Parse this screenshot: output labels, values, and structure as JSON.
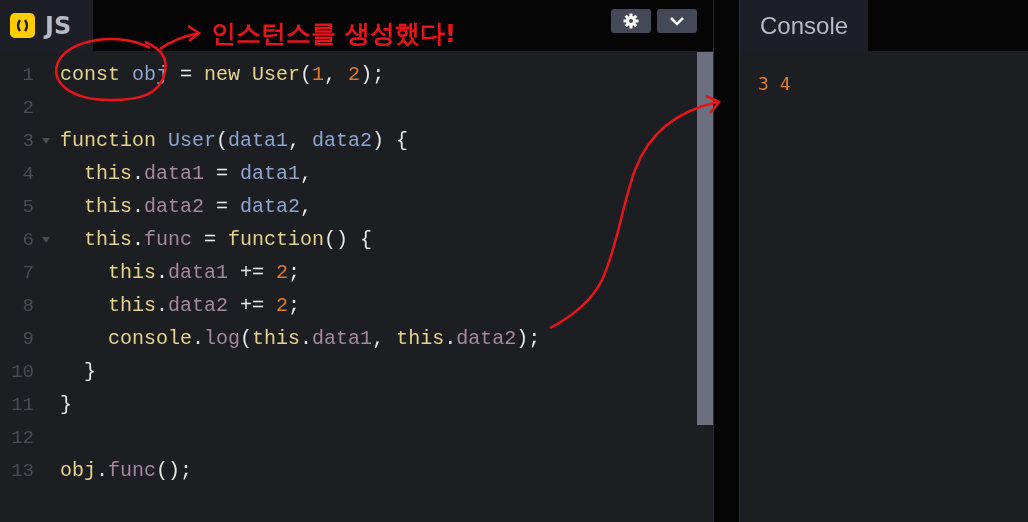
{
  "editor": {
    "tab": {
      "label": "JS"
    },
    "lines": [
      {
        "number": "1",
        "fold": false,
        "tokens": [
          {
            "text": "const ",
            "kind": "kw"
          },
          {
            "text": "obj",
            "kind": "var"
          },
          {
            "text": " = ",
            "kind": "plain"
          },
          {
            "text": "new User",
            "kind": "kw"
          },
          {
            "text": "(",
            "kind": "plain"
          },
          {
            "text": "1",
            "kind": "num"
          },
          {
            "text": ", ",
            "kind": "plain"
          },
          {
            "text": "2",
            "kind": "num"
          },
          {
            "text": ");",
            "kind": "plain"
          }
        ]
      },
      {
        "number": "2",
        "fold": false
      },
      {
        "number": "3",
        "fold": true,
        "tokens": [
          {
            "text": "function ",
            "kind": "kw"
          },
          {
            "text": "User",
            "kind": "var"
          },
          {
            "text": "(",
            "kind": "plain"
          },
          {
            "text": "data1",
            "kind": "var"
          },
          {
            "text": ", ",
            "kind": "plain"
          },
          {
            "text": "data2",
            "kind": "var"
          },
          {
            "text": ") {",
            "kind": "plain"
          }
        ]
      },
      {
        "number": "4",
        "fold": false,
        "tokens": [
          {
            "text": "  this",
            "kind": "kw"
          },
          {
            "text": ".",
            "kind": "plain"
          },
          {
            "text": "data1",
            "kind": "prop"
          },
          {
            "text": " = ",
            "kind": "plain"
          },
          {
            "text": "data1",
            "kind": "var"
          },
          {
            "text": ",",
            "kind": "plain"
          }
        ]
      },
      {
        "number": "5",
        "fold": false,
        "tokens": [
          {
            "text": "  this",
            "kind": "kw"
          },
          {
            "text": ".",
            "kind": "plain"
          },
          {
            "text": "data2",
            "kind": "prop"
          },
          {
            "text": " = ",
            "kind": "plain"
          },
          {
            "text": "data2",
            "kind": "var"
          },
          {
            "text": ",",
            "kind": "plain"
          }
        ]
      },
      {
        "number": "6",
        "fold": true,
        "tokens": [
          {
            "text": "  this",
            "kind": "kw"
          },
          {
            "text": ".",
            "kind": "plain"
          },
          {
            "text": "func",
            "kind": "prop"
          },
          {
            "text": " = ",
            "kind": "plain"
          },
          {
            "text": "function",
            "kind": "kw"
          },
          {
            "text": "() {",
            "kind": "plain"
          }
        ]
      },
      {
        "number": "7",
        "fold": false,
        "tokens": [
          {
            "text": "    this",
            "kind": "kw"
          },
          {
            "text": ".",
            "kind": "plain"
          },
          {
            "text": "data1",
            "kind": "prop"
          },
          {
            "text": " += ",
            "kind": "plain"
          },
          {
            "text": "2",
            "kind": "num"
          },
          {
            "text": ";",
            "kind": "plain"
          }
        ]
      },
      {
        "number": "8",
        "fold": false,
        "tokens": [
          {
            "text": "    this",
            "kind": "kw"
          },
          {
            "text": ".",
            "kind": "plain"
          },
          {
            "text": "data2",
            "kind": "prop"
          },
          {
            "text": " += ",
            "kind": "plain"
          },
          {
            "text": "2",
            "kind": "num"
          },
          {
            "text": ";",
            "kind": "plain"
          }
        ]
      },
      {
        "number": "9",
        "fold": false,
        "tokens": [
          {
            "text": "    console",
            "kind": "kw"
          },
          {
            "text": ".",
            "kind": "plain"
          },
          {
            "text": "log",
            "kind": "prop"
          },
          {
            "text": "(",
            "kind": "plain"
          },
          {
            "text": "this",
            "kind": "kw"
          },
          {
            "text": ".",
            "kind": "plain"
          },
          {
            "text": "data1",
            "kind": "prop"
          },
          {
            "text": ", ",
            "kind": "plain"
          },
          {
            "text": "this",
            "kind": "kw"
          },
          {
            "text": ".",
            "kind": "plain"
          },
          {
            "text": "data2",
            "kind": "prop"
          },
          {
            "text": ");",
            "kind": "plain"
          }
        ]
      },
      {
        "number": "10",
        "fold": false,
        "tokens": [
          {
            "text": "  }",
            "kind": "plain"
          }
        ]
      },
      {
        "number": "11",
        "fold": false,
        "tokens": [
          {
            "text": "}",
            "kind": "plain"
          }
        ]
      },
      {
        "number": "12",
        "fold": false
      },
      {
        "number": "13",
        "fold": false,
        "tokens": [
          {
            "text": "obj",
            "kind": "kw"
          },
          {
            "text": ".",
            "kind": "plain"
          },
          {
            "text": "func",
            "kind": "prop"
          },
          {
            "text": "();",
            "kind": "plain"
          }
        ]
      }
    ]
  },
  "console": {
    "tab": {
      "label": "Console"
    },
    "output_lines": [
      "3 4"
    ]
  },
  "annotation": {
    "text": "인스턴스를 생성했다!"
  }
}
